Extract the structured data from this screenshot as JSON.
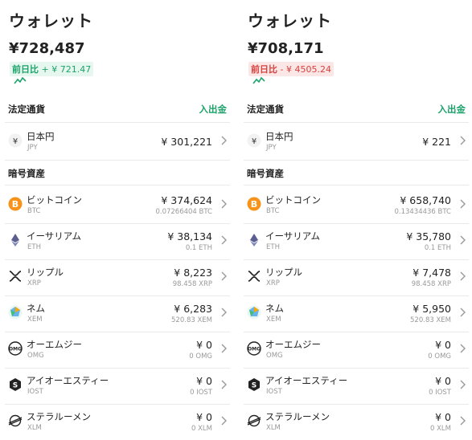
{
  "colors": {
    "accent_green": "#1ba36a",
    "down_red": "#d8403e",
    "btc_orange": "#f7931a",
    "divider": "#e9e9e9"
  },
  "panels": [
    {
      "title": "ウォレット",
      "total": "¥728,487",
      "change_label": "前日比",
      "change_value": "+ ¥ 721.47",
      "change_dir": "up",
      "fiat_section": "法定通貨",
      "deposit_link": "入出金",
      "crypto_section": "暗号資産",
      "fiat": {
        "name": "日本円",
        "symbol": "JPY",
        "value": "¥ 301,221",
        "icon": "yen-icon"
      },
      "assets": [
        {
          "name": "ビットコイン",
          "symbol": "BTC",
          "value": "¥ 374,624",
          "amount": "0.07266404 BTC",
          "icon": "bitcoin-icon"
        },
        {
          "name": "イーサリアム",
          "symbol": "ETH",
          "value": "¥ 38,134",
          "amount": "0.1 ETH",
          "icon": "ethereum-icon"
        },
        {
          "name": "リップル",
          "symbol": "XRP",
          "value": "¥ 8,223",
          "amount": "98.458 XRP",
          "icon": "ripple-icon"
        },
        {
          "name": "ネム",
          "symbol": "XEM",
          "value": "¥ 6,283",
          "amount": "520.83 XEM",
          "icon": "nem-icon"
        },
        {
          "name": "オーエムジー",
          "symbol": "OMG",
          "value": "¥ 0",
          "amount": "0 OMG",
          "icon": "omg-icon"
        },
        {
          "name": "アイオーエスティー",
          "symbol": "IOST",
          "value": "¥ 0",
          "amount": "0 IOST",
          "icon": "iost-icon"
        },
        {
          "name": "ステラルーメン",
          "symbol": "XLM",
          "value": "¥ 0",
          "amount": "0 XLM",
          "icon": "stellar-icon"
        }
      ]
    },
    {
      "title": "ウォレット",
      "total": "¥708,171",
      "change_label": "前日比",
      "change_value": "- ¥ 4505.24",
      "change_dir": "down",
      "fiat_section": "法定通貨",
      "deposit_link": "入出金",
      "crypto_section": "暗号資産",
      "fiat": {
        "name": "日本円",
        "symbol": "JPY",
        "value": "¥ 221",
        "icon": "yen-icon"
      },
      "assets": [
        {
          "name": "ビットコイン",
          "symbol": "BTC",
          "value": "¥ 658,740",
          "amount": "0.13434436 BTC",
          "icon": "bitcoin-icon"
        },
        {
          "name": "イーサリアム",
          "symbol": "ETH",
          "value": "¥ 35,780",
          "amount": "0.1 ETH",
          "icon": "ethereum-icon"
        },
        {
          "name": "リップル",
          "symbol": "XRP",
          "value": "¥ 7,478",
          "amount": "98.458 XRP",
          "icon": "ripple-icon"
        },
        {
          "name": "ネム",
          "symbol": "XEM",
          "value": "¥ 5,950",
          "amount": "520.83 XEM",
          "icon": "nem-icon"
        },
        {
          "name": "オーエムジー",
          "symbol": "OMG",
          "value": "¥ 0",
          "amount": "0 OMG",
          "icon": "omg-icon"
        },
        {
          "name": "アイオーエスティー",
          "symbol": "IOST",
          "value": "¥ 0",
          "amount": "0 IOST",
          "icon": "iost-icon"
        },
        {
          "name": "ステラルーメン",
          "symbol": "XLM",
          "value": "¥ 0",
          "amount": "0 XLM",
          "icon": "stellar-icon"
        }
      ]
    }
  ]
}
